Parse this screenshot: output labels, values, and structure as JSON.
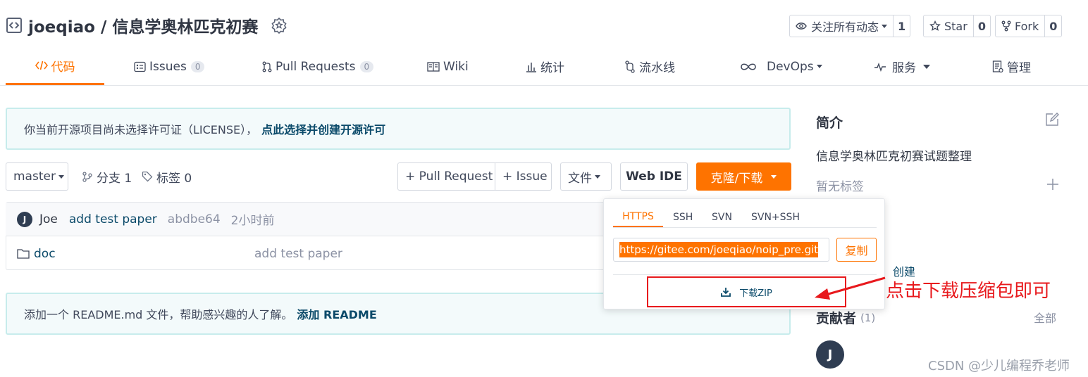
{
  "header": {
    "repo_title": "joeqiao / 信息学奥林匹克初赛",
    "watch_label": "关注所有动态",
    "watch_count": "1",
    "star_label": "Star",
    "star_count": "0",
    "fork_label": "Fork",
    "fork_count": "0"
  },
  "nav": {
    "tabs": [
      {
        "label": "代码",
        "icon": "code-icon",
        "active": true
      },
      {
        "label": "Issues",
        "badge": "0",
        "icon": "issues-icon"
      },
      {
        "label": "Pull Requests",
        "badge": "0",
        "icon": "pull-request-icon"
      },
      {
        "label": "Wiki",
        "icon": "wiki-icon"
      },
      {
        "label": "统计",
        "icon": "stats-icon"
      },
      {
        "label": "流水线",
        "icon": "pipeline-icon"
      },
      {
        "label": "DevOps",
        "icon": "infinity-icon"
      },
      {
        "label": "服务",
        "icon": "pulse-icon"
      },
      {
        "label": "管理",
        "icon": "manage-icon"
      }
    ]
  },
  "license_alert": {
    "text": "你当前开源项目尚未选择许可证（LICENSE），",
    "link": "点此选择并创建开源许可"
  },
  "toolbar": {
    "branch": "master",
    "branches_label": "分支 1",
    "tags_label": "标签 0",
    "pull_request_btn": "+ Pull Request",
    "issue_btn": "+ Issue",
    "file_btn": "文件",
    "web_ide_btn": "Web IDE",
    "clone_btn": "克隆/下载"
  },
  "commit": {
    "avatar_letter": "J",
    "author": "Joe",
    "message": "add test paper",
    "hash": "abdbe64",
    "time": "2小时前"
  },
  "files": [
    {
      "name": "doc",
      "message": "add test paper"
    }
  ],
  "readme_alert": {
    "text": "添加一个 README.md 文件，帮助感兴趣的人了解。",
    "link": "添加 README"
  },
  "clone_panel": {
    "tabs": [
      "HTTPS",
      "SSH",
      "SVN",
      "SVN+SSH"
    ],
    "active_tab": "HTTPS",
    "url": "https://gitee.com/joeqiao/noip_pre.git",
    "copy_label": "复制",
    "download_zip_label": "下载ZIP"
  },
  "annotation": {
    "text": "点击下载压缩包即可",
    "color": "#e8191d"
  },
  "sidebar": {
    "intro_title": "简介",
    "description": "信息学奥林匹克初赛试题整理",
    "no_tags": "暂无标签",
    "create_label": "创建",
    "contributors_title": "贡献者",
    "contributors_count": "(1)",
    "all_label": "全部",
    "contributor_letter": "J"
  },
  "watermark": "CSDN @少儿编程乔老师",
  "colors": {
    "accent": "#fe7300",
    "alert_bg": "#f3fafb",
    "alert_border": "#c7ecec",
    "link": "#0b4a6a",
    "annotation": "#e8191d"
  }
}
